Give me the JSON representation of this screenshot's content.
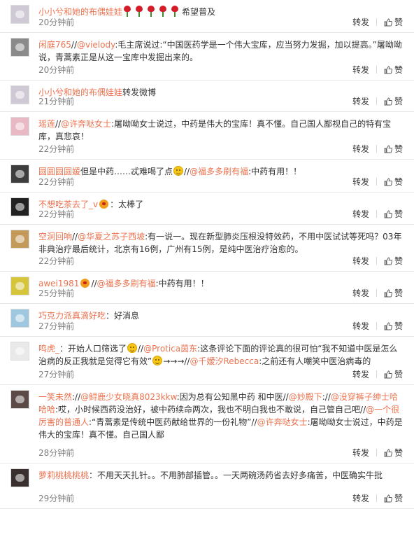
{
  "comments": [
    {
      "user": "小小兮和她的布偶娃娃",
      "avatar_color": "#cfc9d6",
      "parts": [
        {
          "t": "rose"
        },
        {
          "t": "rose"
        },
        {
          "t": "rose"
        },
        {
          "t": "rose"
        },
        {
          "t": "rose"
        },
        {
          "t": "text",
          "v": "希望普及"
        }
      ],
      "time": "20分钟前",
      "repost": "转发",
      "like": "赞"
    },
    {
      "user": "闲庭765",
      "avatar_color": "#8a8a8a",
      "parts": [
        {
          "t": "text",
          "v": "//"
        },
        {
          "t": "mention",
          "v": "@vielody"
        },
        {
          "t": "text",
          "v": ":毛主席说过:“中国医药学是一个伟大宝库，应当努力发掘，加以提高。”屠呦呦说，青蒿素正是从这一宝库中发掘出来的。"
        }
      ],
      "time": "20分钟前",
      "repost": "转发",
      "like": "赞"
    },
    {
      "user": "小小兮和她的布偶娃娃",
      "avatar_color": "#cfc9d6",
      "parts": [
        {
          "t": "text",
          "v": "转发微博"
        }
      ],
      "time": "21分钟前",
      "repost": "转发",
      "like": "赞"
    },
    {
      "user": "瑶莲",
      "avatar_color": "#e8b9c4",
      "parts": [
        {
          "t": "text",
          "v": "//"
        },
        {
          "t": "mention",
          "v": "@许奔哒女士"
        },
        {
          "t": "text",
          "v": ":屠呦呦女士说过，中药是伟大的宝库！真不懂。自己国人鄙视自己的特有宝库，真悲哀！"
        }
      ],
      "time": "22分钟前",
      "repost": "转发",
      "like": "赞"
    },
    {
      "user": "圆圆圆圆媛",
      "avatar_color": "#3d3d3d",
      "parts": [
        {
          "t": "text",
          "v": "但是中药……忒难喝了点"
        },
        {
          "t": "smile"
        },
        {
          "t": "text",
          "v": "//"
        },
        {
          "t": "mention",
          "v": "@福多多刷有福"
        },
        {
          "t": "text",
          "v": ":中药有用！！"
        }
      ],
      "time": "22分钟前",
      "repost": "转发",
      "like": "赞"
    },
    {
      "user": "不想吃茶去了_v",
      "avatar_color": "#222222",
      "parts": [
        {
          "t": "badge"
        },
        {
          "t": "text",
          "v": "：太棒了"
        }
      ],
      "time": "22分钟前",
      "repost": "转发",
      "like": "赞"
    },
    {
      "user": "空洞回响",
      "avatar_color": "#c49a5a",
      "parts": [
        {
          "t": "text",
          "v": "//"
        },
        {
          "t": "mention",
          "v": "@华夏之苏子西坡"
        },
        {
          "t": "text",
          "v": ":有一说一。现在新型肺炎压根没特效药，不用中医试试等死吗？03年非典治疗最后统计，北京有16例，广州有15例，是纯中医治疗治愈的。"
        }
      ],
      "time": "22分钟前",
      "repost": "转发",
      "like": "赞"
    },
    {
      "user": "awei1981",
      "avatar_color": "#d6c43a",
      "parts": [
        {
          "t": "badge"
        },
        {
          "t": "text",
          "v": "//"
        },
        {
          "t": "mention",
          "v": "@福多多刷有福"
        },
        {
          "t": "text",
          "v": ":中药有用！！"
        }
      ],
      "time": "25分钟前",
      "repost": "转发",
      "like": "赞"
    },
    {
      "user": "巧克力派真滴好吃",
      "avatar_color": "#9fc8e0",
      "parts": [
        {
          "t": "text",
          "v": "：好消息"
        }
      ],
      "time": "27分钟前",
      "repost": "转发",
      "like": "赞"
    },
    {
      "user": "鸣虎_",
      "avatar_color": "#e9e9e9",
      "parts": [
        {
          "t": "text",
          "v": "：开始人口筛选了"
        },
        {
          "t": "smile"
        },
        {
          "t": "text",
          "v": "//"
        },
        {
          "t": "mention",
          "v": "@Protica茵东"
        },
        {
          "t": "text",
          "v": ":这条评论下面的评论真的很可怕"
        },
        {
          "t": "text",
          "v": "“我不知道中医是怎么治病的反正我就是觉得它有效”"
        },
        {
          "t": "smile"
        },
        {
          "t": "text",
          "v": "→→→//"
        },
        {
          "t": "mention",
          "v": "@千嫒汐Rebecca"
        },
        {
          "t": "text",
          "v": ":之前还有人嘲笑中医治病毒的"
        }
      ],
      "time": "27分钟前",
      "repost": "转发",
      "like": "赞"
    },
    {
      "user": "一笑未然",
      "avatar_color": "#5c4a47",
      "parts": [
        {
          "t": "text",
          "v": "://"
        },
        {
          "t": "mention",
          "v": "@鲟鹿少女晓真8023kkw"
        },
        {
          "t": "text",
          "v": ":因为总有公知黑中药 和中医//"
        },
        {
          "t": "mention",
          "v": "@妙殿下"
        },
        {
          "t": "text",
          "v": "://"
        },
        {
          "t": "mention",
          "v": "@没穿裤子绅士哈哈哈"
        },
        {
          "t": "text",
          "v": ":哎，小时候西药没治好，被中药续命两次，我也不明白我也不敢说，自己管自己吧//"
        },
        {
          "t": "mention",
          "v": "@一个很厉害的普通人"
        },
        {
          "t": "text",
          "v": ":“青蒿素是传统中医药献给世界的一份礼物”//"
        },
        {
          "t": "mention",
          "v": "@许奔哒女士"
        },
        {
          "t": "text",
          "v": ":屠呦呦女士说过，中药是伟大的宝库！真不懂。自己国人鄙"
        }
      ],
      "time": "28分钟前",
      "repost": "转发",
      "like": "赞"
    },
    {
      "user": "萝莉桃桃桃桃",
      "avatar_color": "#3a2f2f",
      "parts": [
        {
          "t": "text",
          "v": "：不用天天扎针。。不用肺部插管。。一天两碗汤药省去好多痛苦，中医确实牛批"
        }
      ],
      "time": "29分钟前",
      "repost": "转发",
      "like": "赞"
    }
  ]
}
